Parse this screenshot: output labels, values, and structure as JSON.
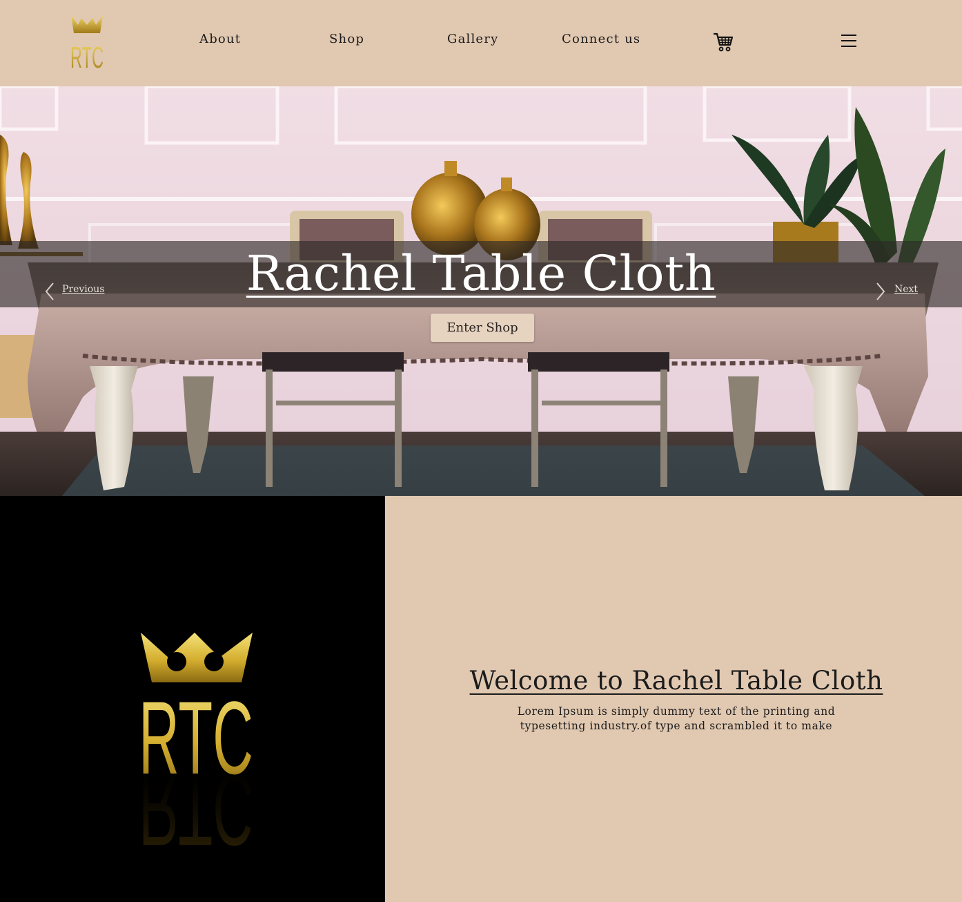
{
  "header": {
    "logo_text": "RTC",
    "nav": [
      "About",
      "Shop",
      "Gallery",
      "Connect us"
    ],
    "cart_icon": "shopping-cart-icon",
    "menu_icon": "hamburger-menu-icon"
  },
  "hero": {
    "title": "Rachel Table Cloth",
    "previous_label": "Previous",
    "next_label": "Next",
    "cta_label": "Enter Shop"
  },
  "welcome": {
    "logo_text": "RTC",
    "title": "Welcome to Rachel Table Cloth",
    "body": "Lorem Ipsum is simply dummy text of the printing and typesetting industry.of type and scrambled it to make"
  },
  "colors": {
    "background": "#e1c8b1",
    "gold": "#c9a227",
    "text": "#1b1b1b",
    "logo_panel": "#000000"
  }
}
